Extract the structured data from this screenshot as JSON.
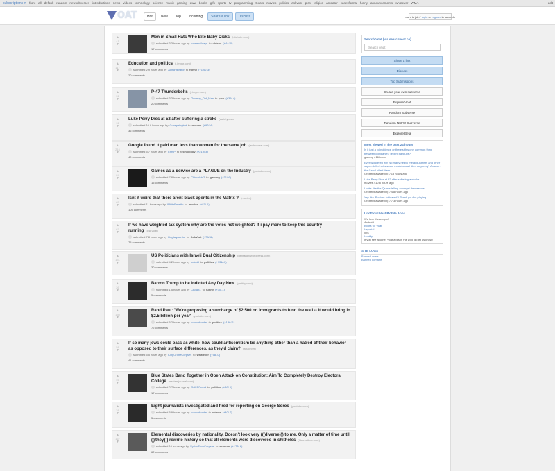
{
  "topbar": {
    "subscriptions": "subscriptions ▾",
    "items": [
      "front",
      "all",
      "default",
      "random",
      "newsubverses",
      "introductions",
      "news",
      "videos",
      "technology",
      "science",
      "music",
      "gaming",
      "aww",
      "books",
      "gifs",
      "sports",
      "tv",
      "programming",
      "Goats",
      "movies",
      "politics",
      "askvoat",
      "pics",
      "religion",
      "anteater",
      "casesformal",
      "funny",
      "announcements",
      "whatever",
      "WMA"
    ],
    "edit": "edit"
  },
  "header": {
    "logo_v": "V",
    "logo_text": "OAT",
    "tabs": [
      {
        "label": "Hot",
        "style": "active"
      },
      {
        "label": "New",
        "style": "plain"
      },
      {
        "label": "Top",
        "style": "plain"
      },
      {
        "label": "Incoming",
        "style": "plain"
      },
      {
        "label": "Share a link",
        "style": "blue"
      },
      {
        "label": "Discuss",
        "style": "blue"
      }
    ],
    "login_prefix": "want to join?",
    "login_link": "login",
    "login_mid": "or",
    "register_link": "register",
    "login_suffix": "in seconds"
  },
  "posts": [
    {
      "votes": "41",
      "thumb": "#3a3a3a",
      "title": "Men in Small Hats Who Bite Baby Dicks",
      "domain": "(bitchute.com)",
      "submitted": "submitted 3.3 hours ago by",
      "user": "Inuriem4days",
      "to": "to",
      "sub": "videos",
      "score": "(+44/-0)",
      "comments": "17 comments"
    },
    {
      "votes": "117",
      "thumb": "",
      "title": "Education and politics",
      "domain": "(i.imgur.com)",
      "submitted": "submitted 2.9 hours ago by",
      "user": "Administrator",
      "to": "to",
      "sub": "funny",
      "score": "(+128/-3)",
      "comments": "20 comments"
    },
    {
      "votes": "31",
      "thumb": "#8694a6",
      "title": "P-47 Thunderbolts",
      "domain": "(i.imgur.com)",
      "submitted": "submitted 3.3 hours ago by",
      "user": "Grumpy_Old_Man",
      "to": "to",
      "sub": "pics",
      "score": "(+35/-4)",
      "comments": "20 comments"
    },
    {
      "votes": "92",
      "thumb": "",
      "title": "Luke Perry Dies at 52 after suffering a stroke",
      "domain": "(variety.com)",
      "submitted": "submitted 10.8 hours ago by",
      "user": "Conspiringbot",
      "to": "to",
      "sub": "movies",
      "score": "(+92/-4)",
      "comments": "36 comments"
    },
    {
      "votes": "216",
      "thumb": "",
      "title": "Google found it paid men less than women for the same job",
      "domain": "(technocrat.com)",
      "submitted": "submitted 5.7 hours ago by",
      "user": "EntsP",
      "to": "to",
      "sub": "technology",
      "score": "(+219/-4)",
      "comments": "40 comments"
    },
    {
      "votes": "24",
      "thumb": "#1a1a1a",
      "title": "Games as a Service are a PLAGUE on the Industry",
      "domain": "(youtube.com)",
      "submitted": "submitted 7.8 hours ago by",
      "user": "Chimalstd2",
      "to": "to",
      "sub": "gaming",
      "score": "(+31/-6)",
      "comments": "15 comments"
    },
    {
      "votes": "65",
      "thumb": "",
      "title": "Isnt it weird that there arent black agents in the Matrix ?",
      "domain": "(movies)",
      "submitted": "submitted 11 hours ago by",
      "user": "WhitePaladin",
      "to": "to",
      "sub": "movies",
      "score": "(+87/-1)",
      "comments": "105 comments"
    },
    {
      "votes": "67",
      "thumb": "",
      "title": "If we have weighted tax system why are the votes not weighted? If i pay more to keep this country running",
      "domain": "(AskVoat)",
      "submitted": "submitted 7.8 hours ago by",
      "user": "Dogtagwarrior",
      "to": "to",
      "sub": "AskVoat",
      "score": "(+75/-6)",
      "comments": "75 comments"
    },
    {
      "votes": "131",
      "thumb": "#cfcfcf",
      "title": "US Politicians with Israeli Dual Citizenship",
      "domain": "(gentanim.wordpress.com)",
      "submitted": "submitted 4.2 hours ago by",
      "user": "kokoid",
      "to": "to",
      "sub": "politics",
      "score": "(+131/-0)",
      "comments": "30 comments"
    },
    {
      "votes": "26",
      "thumb": "#2c2c2c",
      "title": "Barron Trump to be Indicted Any Day Now",
      "domain": "(prettily.com)",
      "submitted": "submitted 1.5 hours ago by",
      "user": "CB4881",
      "to": "to",
      "sub": "funny",
      "score": "(+30/-1)",
      "comments": "5 comments"
    },
    {
      "votes": "130",
      "thumb": "#4a4a4a",
      "title": "Rand Paul: 'We're proposing a surcharge of $2,500 on immigrants to fund the wall -- it would bring in $2.5 billion per year'",
      "domain": "(youtube.com)",
      "submitted": "submitted 5.2 hours ago by",
      "user": "nowonborder",
      "to": "to",
      "sub": "politics",
      "score": "(+136/-1)",
      "comments": "72 comments"
    },
    {
      "votes": "58",
      "thumb": "",
      "title": "If so many jews could pass as white, how could antisemitism be anything other than a hatred of their behavior as opposed to their surface differences, as they'd claim?",
      "domain": "(whatever)",
      "submitted": "submitted 5.5 hours ago by",
      "user": "KingOfTheCorpses",
      "to": "to",
      "sub": "whatever",
      "score": "(+58/-0)",
      "comments": "41 comments"
    },
    {
      "votes": "46",
      "thumb": "#333333",
      "title": "Blue States Band Together in Open Attack on Constitution: Aim To Completely Destroy Electoral College",
      "domain": "(eastemjournal.com)",
      "submitted": "submitted 2.7 hours ago by",
      "user": "Roll-RDneat",
      "to": "to",
      "sub": "politics",
      "score": "(+46/-1)",
      "comments": "17 comments"
    },
    {
      "votes": "38",
      "thumb": "#2a2a2a",
      "title": "Eight journalists investigated and fired for reporting on George Soros",
      "domain": "(youtube.com)",
      "submitted": "submitted 5.9 hours ago by",
      "user": "nowonborder",
      "to": "to",
      "sub": "videos",
      "score": "(+40/-2)",
      "comments": "5 comments"
    },
    {
      "votes": "167",
      "thumb": "#5a5a5a",
      "title": "Elemental discoveries by nationality. Doesn't look very (((diverse))) to me. Only a matter of time until (((they))) rewrite history so that all elements were discovered in shitholes",
      "domain": "(files.catbox.moe)",
      "submitted": "submitted 10 hours ago by",
      "user": "SyrianFuckCorpses",
      "to": "to",
      "sub": "science",
      "score": "(+173/-6)",
      "comments": "62 comments"
    }
  ],
  "sidebar": {
    "search_header": "Search Voat (via searchvoat.co)",
    "search_placeholder": "Search Voat",
    "buttons": [
      {
        "label": "Share a link",
        "style": "blue"
      },
      {
        "label": "Discuss",
        "style": "blue"
      },
      {
        "label": "Top Submissions",
        "style": "blue"
      },
      {
        "label": "Create your own subverse",
        "style": "plain"
      },
      {
        "label": "Explore Voat",
        "style": "plain"
      },
      {
        "label": "Random Subverse",
        "style": "plain"
      },
      {
        "label": "Random NSFW Subverse",
        "style": "plain"
      },
      {
        "label": "Explore Beta",
        "style": "plain"
      }
    ],
    "most_viewed_header": "Most viewed in the past 24 hours",
    "most_viewed": [
      {
        "title": "Is it just a coincidence or there's this one common thing between companies' recent bankups?",
        "meta": "gaming / 16 hours"
      },
      {
        "title": "Ever wondered why so many heavy metal guitarists and other super-skilled artists and musicians all died so young? Answer: the Cabal killed them",
        "meta": "Greatfiveawakening / 13 hours ago"
      },
      {
        "title": "Luke Perry Dies at 52 after suffering a stroke",
        "meta": "movies / 10.8 hours ago"
      },
      {
        "title": "Looks like the Qs are telling amongst themselves",
        "meta": "Greatfiveawakening / 4.8 hours ago"
      },
      {
        "title": "Yep like 'Posture Activated'? Thank you for playing",
        "meta": "Greatfiveawakening / 7.3 hours ago"
      }
    ],
    "apps_header": "Unofficial Voat Mobile Apps",
    "apps_intro": "We love these apps!",
    "apps_android": "Android",
    "apps": [
      "Boota for Voat",
      "Vaporial"
    ],
    "apps_ios": "iOS",
    "apps_ios_list": [
      "Voatify"
    ],
    "apps_footer": "If you see another Voat apps in the wild, do let us know!",
    "sitelogs_header": "SITE LOGS",
    "sitelogs": [
      "Banned users",
      "Banned domains"
    ]
  }
}
